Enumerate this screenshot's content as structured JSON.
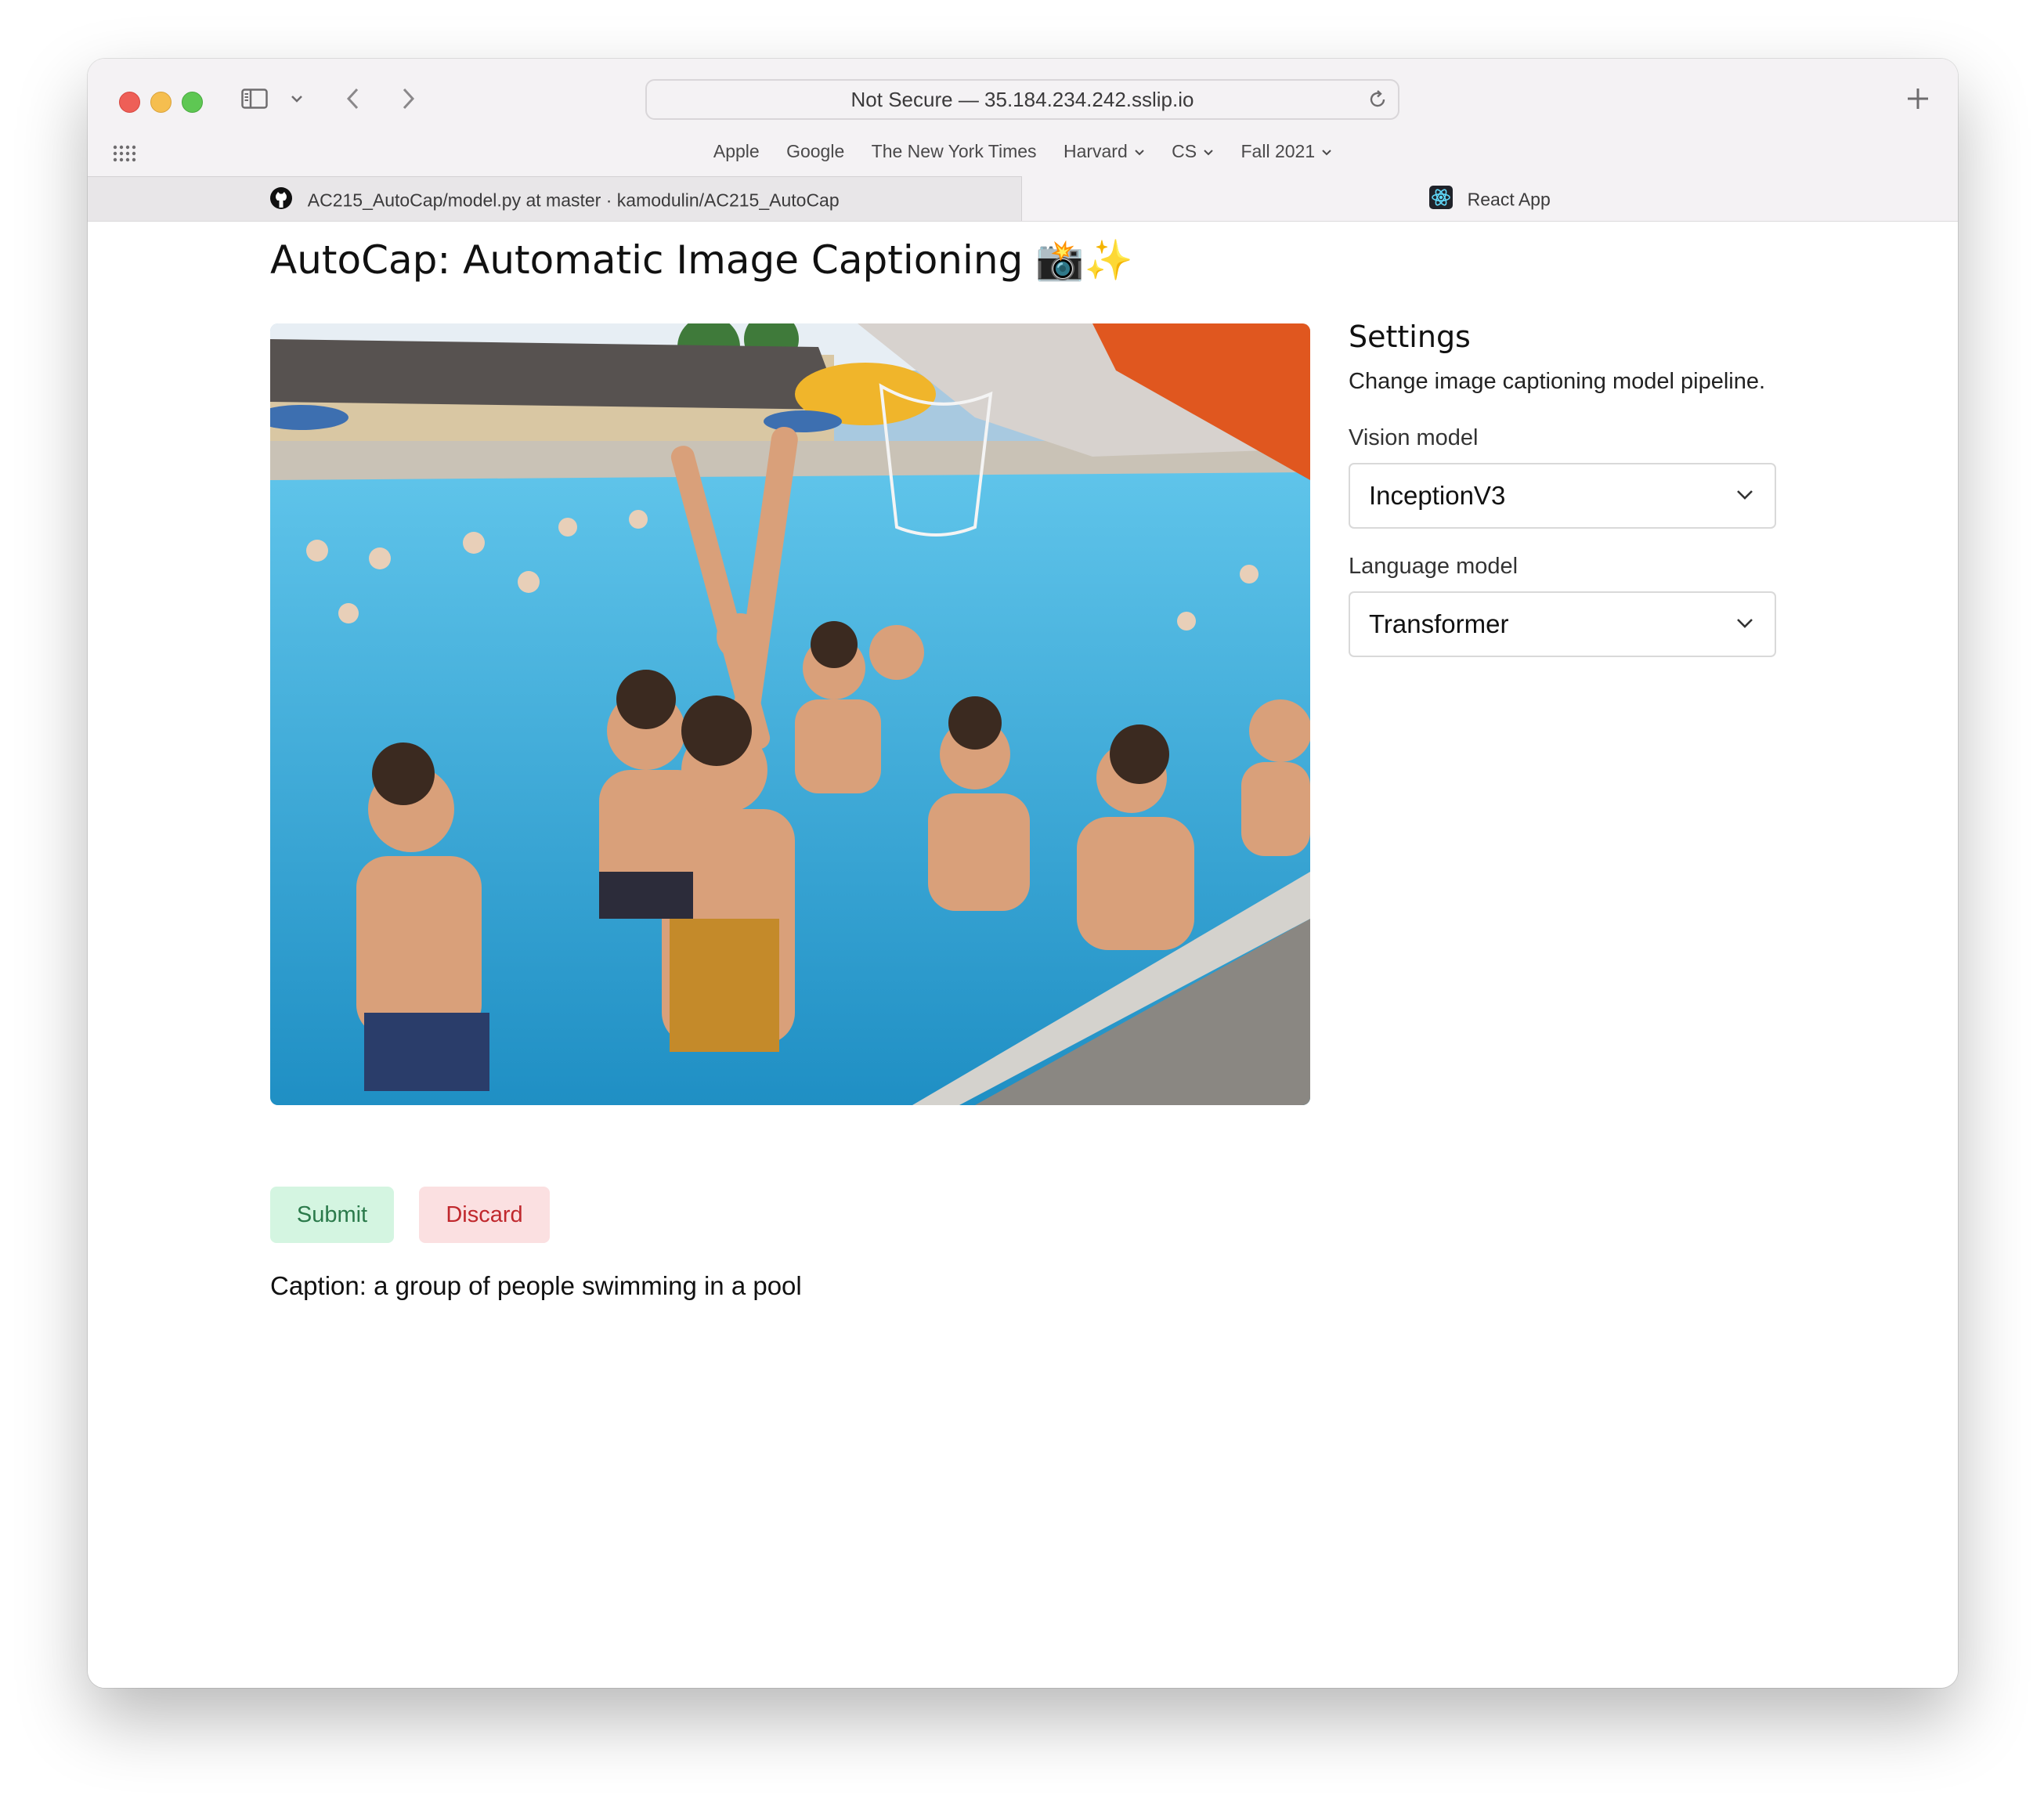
{
  "browser": {
    "address": "Not Secure — 35.184.234.242.sslip.io",
    "bookmarks": [
      {
        "label": "Apple",
        "dropdown": false
      },
      {
        "label": "Google",
        "dropdown": false
      },
      {
        "label": "The New York Times",
        "dropdown": false
      },
      {
        "label": "Harvard",
        "dropdown": true
      },
      {
        "label": "CS",
        "dropdown": true
      },
      {
        "label": "Fall 2021",
        "dropdown": true
      }
    ],
    "tabs": [
      {
        "label": "AC215_AutoCap/model.py at master · kamodulin/AC215_AutoCap",
        "icon": "github-icon",
        "active": false
      },
      {
        "label": "React App",
        "icon": "react-icon",
        "active": true
      }
    ]
  },
  "page": {
    "title": "AutoCap: Automatic Image Captioning 📸✨",
    "photo_description_icon": "uploaded-photo",
    "submit_label": "Submit",
    "discard_label": "Discard",
    "caption": "Caption: a group of people swimming in a pool"
  },
  "settings": {
    "title": "Settings",
    "description": "Change image captioning model pipeline.",
    "vision_label": "Vision model",
    "vision_value": "InceptionV3",
    "language_label": "Language model",
    "language_value": "Transformer"
  },
  "colors": {
    "submit_bg": "#d4f5e1",
    "submit_text": "#2b7a4b",
    "discard_bg": "#fbe0e1",
    "discard_text": "#c0282d",
    "pool_water": "#36a9d6"
  }
}
